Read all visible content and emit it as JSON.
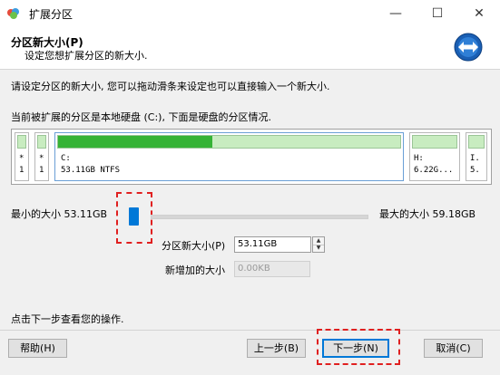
{
  "window": {
    "title": "扩展分区",
    "minimize_glyph": "—",
    "maximize_glyph": "☐",
    "close_glyph": "✕"
  },
  "header": {
    "title": "分区新大小(P)",
    "subtitle": "设定您想扩展分区的新大小."
  },
  "instructions": "请设定分区的新大小, 您可以拖动滑条来设定也可以直接输入一个新大小.",
  "disk_info": "当前被扩展的分区是本地硬盘 (C:), 下面是硬盘的分区情况.",
  "disk_map": {
    "segments": [
      {
        "line1": "*",
        "line2": "1",
        "fill_fraction": 0
      },
      {
        "line1": "*",
        "line2": "1",
        "fill_fraction": 0
      },
      {
        "line1": "C:",
        "line2": "53.11GB NTFS",
        "fill_fraction": 0.45
      },
      {
        "line1": "H:",
        "line2": "6.22G...",
        "fill_fraction": 0
      },
      {
        "line1": "I.",
        "line2": "5.",
        "fill_fraction": 0
      }
    ]
  },
  "slider": {
    "min_label": "最小的大小 53.11GB",
    "max_label": "最大的大小 59.18GB",
    "value_fraction": 0
  },
  "form": {
    "new_size_label": "分区新大小(P)",
    "new_size_value": "53.11GB",
    "added_size_label": "新增加的大小",
    "added_size_value": "0.00KB"
  },
  "footer_text": "点击下一步查看您的操作.",
  "buttons": {
    "help": "帮助(H)",
    "back": "上一步(B)",
    "next": "下一步(N)",
    "cancel": "取消(C)"
  },
  "colors": {
    "accent_blue": "#0078d7",
    "partition_green": "#35b335",
    "highlight_red": "#e02020"
  }
}
